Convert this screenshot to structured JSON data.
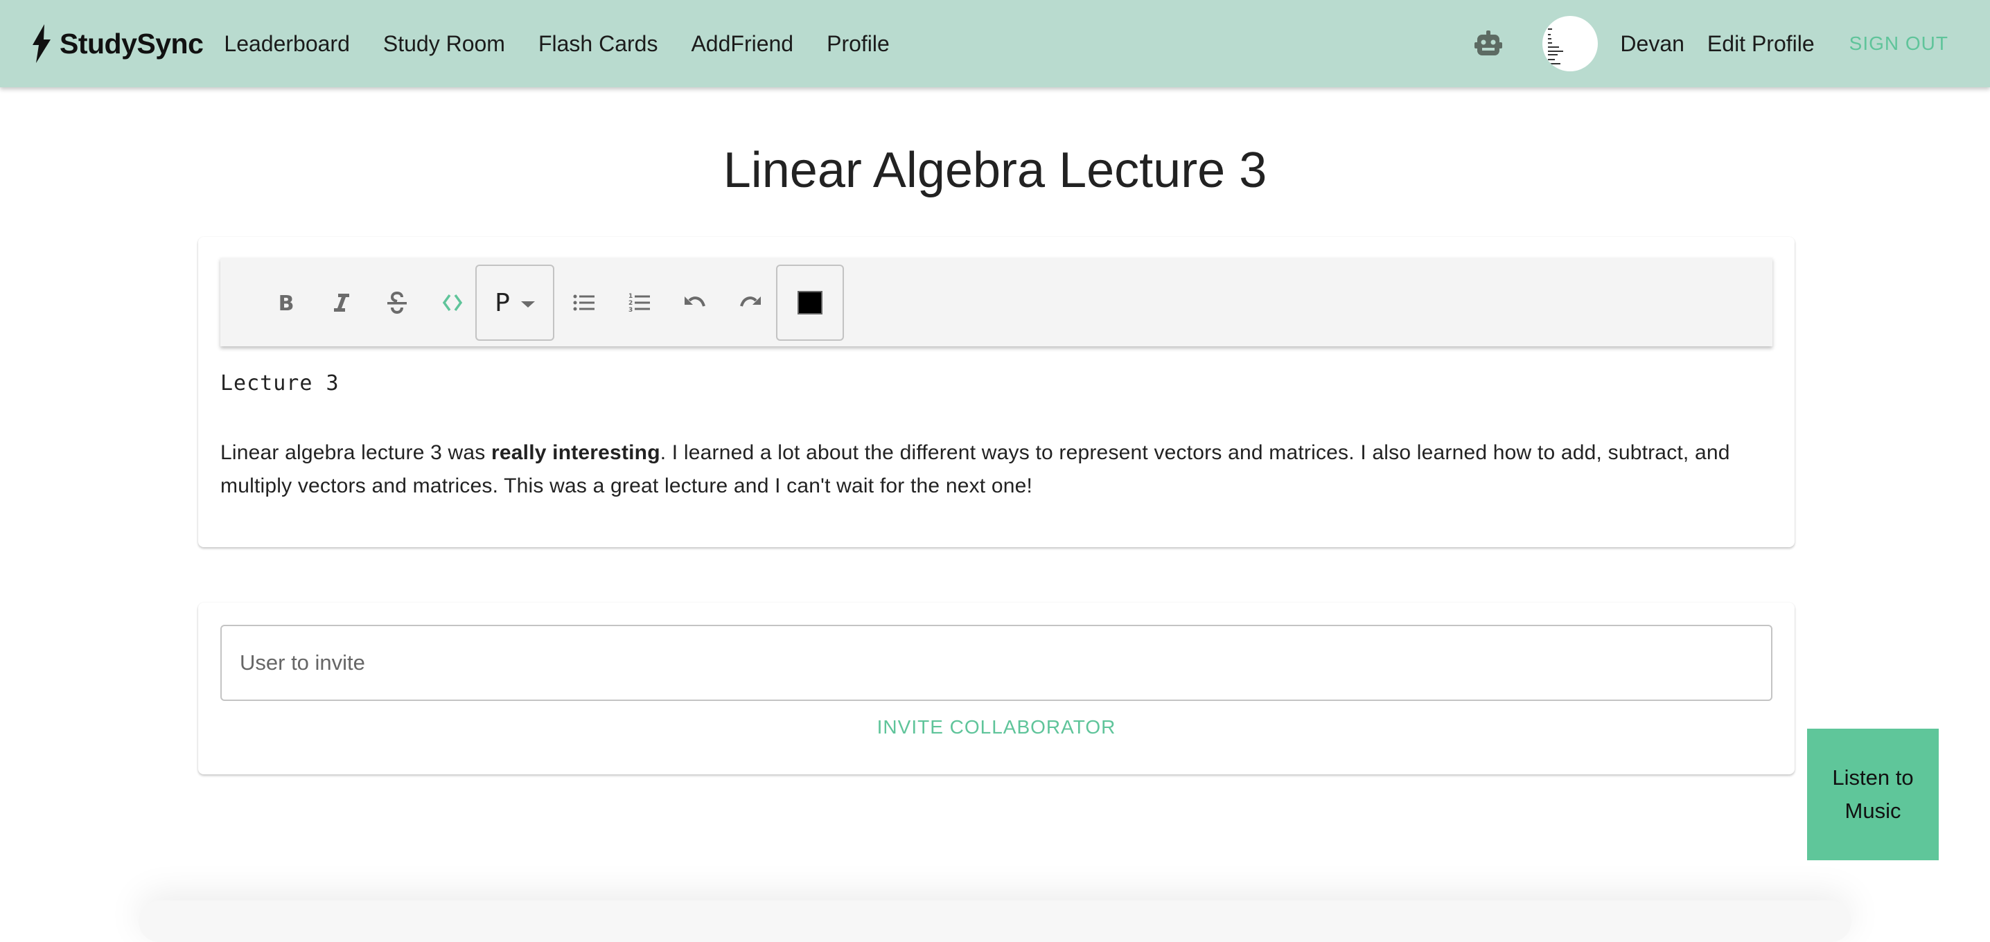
{
  "navbar": {
    "brand": "StudySync",
    "links": [
      "Leaderboard",
      "Study Room",
      "Flash Cards",
      "AddFriend",
      "Profile"
    ],
    "user_name": "Devan",
    "edit_profile": "Edit Profile",
    "sign_out": "SIGN OUT"
  },
  "page": {
    "title": "Linear Algebra Lecture 3"
  },
  "editor": {
    "toolbar": {
      "bold": "bold-icon",
      "italic": "italic-icon",
      "strikethrough": "strikethrough-icon",
      "code": "code-icon",
      "block_type": "P",
      "bullet_list": "bullet-list-icon",
      "numbered_list": "numbered-list-icon",
      "undo": "undo-icon",
      "redo": "redo-icon",
      "text_color": "#000000"
    },
    "heading": "Lecture 3",
    "body_before": "Linear algebra lecture 3 was ",
    "body_bold": "really interesting",
    "body_after": ". I learned a lot about the different ways to represent vectors and matrices. I also learned how to add, subtract, and multiply vectors and matrices. This was a great lecture and I can't wait for the next one!"
  },
  "invite": {
    "placeholder": "User to invite",
    "value": "",
    "button": "INVITE COLLABORATOR"
  },
  "music": {
    "label": "Listen to Music"
  },
  "colors": {
    "navbar_bg": "#b9dbcf",
    "accent": "#5fc49a",
    "music_bg": "#5fc69a"
  }
}
